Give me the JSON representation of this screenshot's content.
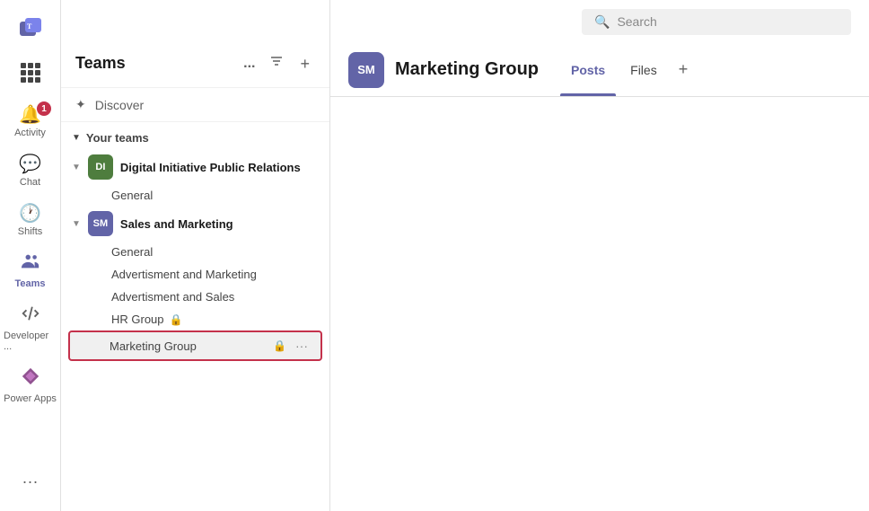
{
  "app": {
    "title": "Microsoft Teams"
  },
  "topbar": {
    "search_placeholder": "Search",
    "search_icon": "search-icon"
  },
  "rail": {
    "items": [
      {
        "id": "activity",
        "label": "Activity",
        "icon": "🔔",
        "badge": "1",
        "active": false
      },
      {
        "id": "chat",
        "label": "Chat",
        "icon": "💬",
        "badge": null,
        "active": false
      },
      {
        "id": "shifts",
        "label": "Shifts",
        "icon": "🕐",
        "badge": null,
        "active": false
      },
      {
        "id": "teams",
        "label": "Teams",
        "icon": "👥",
        "badge": null,
        "active": true
      },
      {
        "id": "developer",
        "label": "Developer ...",
        "icon": "⚙",
        "badge": null,
        "active": false
      },
      {
        "id": "power-apps",
        "label": "Power Apps",
        "icon": "⚡",
        "badge": null,
        "active": false
      }
    ],
    "more_label": "..."
  },
  "teams_panel": {
    "title": "Teams",
    "actions": {
      "more": "...",
      "filter": "≡",
      "add": "+"
    },
    "discover_label": "Discover",
    "your_teams_label": "Your teams",
    "teams": [
      {
        "id": "di",
        "initials": "DI",
        "color": "#4e7d3e",
        "name": "Digital Initiative Public Relations",
        "channels": [
          {
            "name": "General",
            "selected": false,
            "highlighted": false,
            "has_lock": false
          }
        ]
      },
      {
        "id": "sm",
        "initials": "SM",
        "color": "#6264a7",
        "name": "Sales and Marketing",
        "channels": [
          {
            "name": "General",
            "selected": false,
            "highlighted": false,
            "has_lock": false
          },
          {
            "name": "Advertisment and Marketing",
            "selected": false,
            "highlighted": false,
            "has_lock": false
          },
          {
            "name": "Advertisment and Sales",
            "selected": false,
            "highlighted": false,
            "has_lock": false
          },
          {
            "name": "HR Group",
            "selected": false,
            "highlighted": false,
            "has_lock": true
          },
          {
            "name": "Marketing Group",
            "selected": false,
            "highlighted": true,
            "has_lock": true
          }
        ]
      }
    ]
  },
  "main": {
    "group_initials": "SM",
    "group_avatar_color": "#6264a7",
    "group_name": "Marketing Group",
    "tabs": [
      {
        "id": "posts",
        "label": "Posts",
        "active": true
      },
      {
        "id": "files",
        "label": "Files",
        "active": false
      }
    ],
    "add_tab_label": "+"
  }
}
